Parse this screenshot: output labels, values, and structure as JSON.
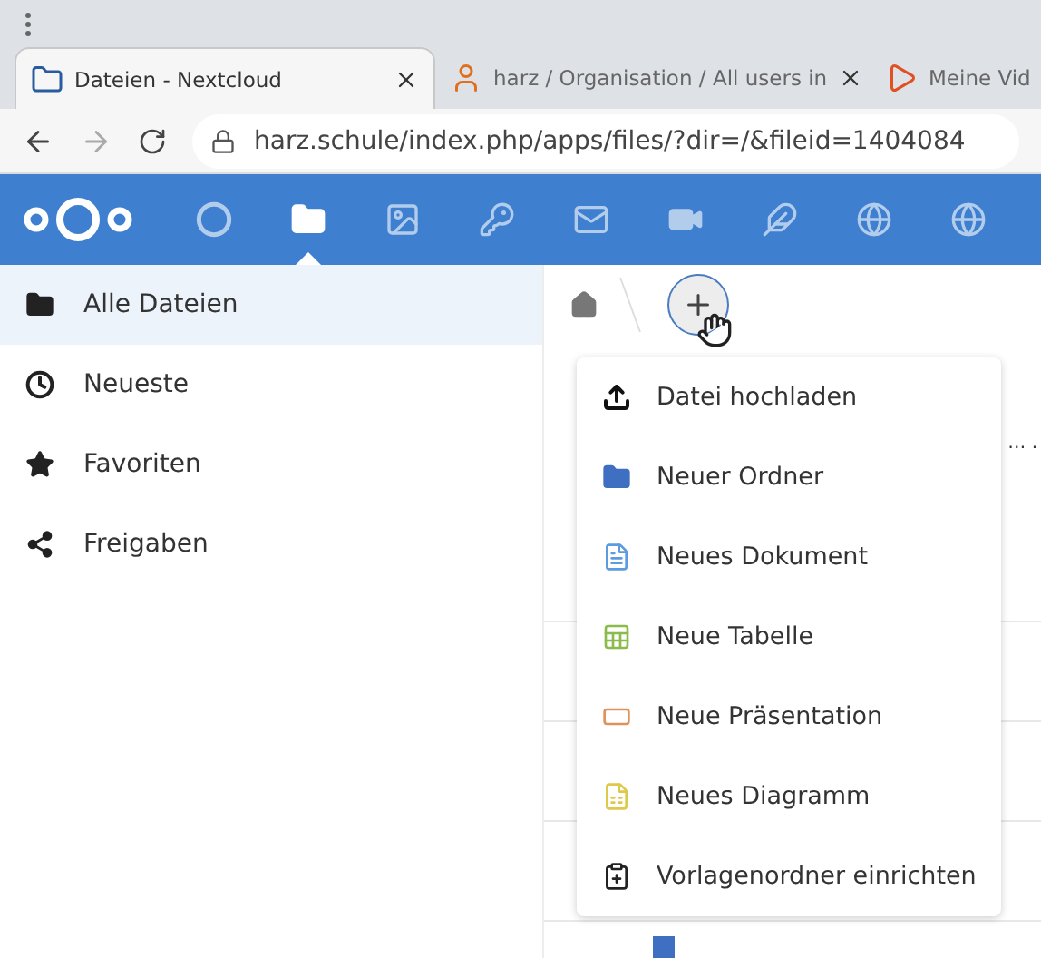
{
  "browser": {
    "tabs": [
      {
        "title": "Dateien - Nextcloud",
        "selected": true,
        "kind": "nextcloud"
      },
      {
        "title": "harz / Organisation / All users in",
        "selected": false,
        "kind": "person"
      },
      {
        "title": "Meine Vid",
        "selected": false,
        "kind": "play"
      }
    ],
    "url": "harz.schule/index.php/apps/files/?dir=/&fileid=1404084"
  },
  "app_nav": [
    {
      "kind": "circle",
      "selected": false
    },
    {
      "kind": "folder",
      "selected": true
    },
    {
      "kind": "image",
      "selected": false
    },
    {
      "kind": "key",
      "selected": false
    },
    {
      "kind": "mail",
      "selected": false
    },
    {
      "kind": "video",
      "selected": false
    },
    {
      "kind": "feather",
      "selected": false
    },
    {
      "kind": "globe",
      "selected": false
    },
    {
      "kind": "globe",
      "selected": false
    }
  ],
  "sidebar": {
    "items": [
      {
        "label": "Alle Dateien",
        "kind": "folder",
        "selected": true
      },
      {
        "label": "Neueste",
        "kind": "clock",
        "selected": false
      },
      {
        "label": "Favoriten",
        "kind": "star",
        "selected": false
      },
      {
        "label": "Freigaben",
        "kind": "share",
        "selected": false
      }
    ]
  },
  "file_list": {
    "row_text": "… ."
  },
  "new_menu": {
    "items": [
      {
        "label": "Datei hochladen",
        "kind": "upload"
      },
      {
        "label": "Neuer Ordner",
        "kind": "folder"
      },
      {
        "label": "Neues Dokument",
        "kind": "document"
      },
      {
        "label": "Neue Tabelle",
        "kind": "spreadsheet"
      },
      {
        "label": "Neue Präsentation",
        "kind": "presentation"
      },
      {
        "label": "Neues Diagramm",
        "kind": "diagram"
      },
      {
        "label": "Vorlagenordner einrichten",
        "kind": "template"
      }
    ]
  }
}
